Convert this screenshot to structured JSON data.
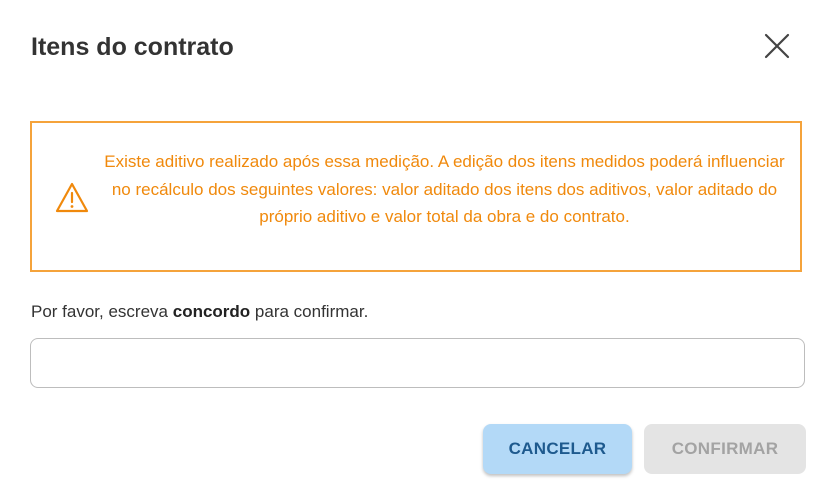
{
  "dialog": {
    "title": "Itens do contrato",
    "close_icon": "close-icon"
  },
  "alert": {
    "icon": "warning-triangle-icon",
    "message": "Existe aditivo realizado após essa medição. A edição dos itens medidos poderá influenciar no recálculo dos seguintes valores: valor aditado dos itens dos aditivos, valor aditado do próprio aditivo e valor total da obra e do contrato.",
    "color": "#f0890c",
    "border_color": "#f5a33b"
  },
  "confirm": {
    "label_prefix": "Por favor, escreva ",
    "label_keyword": "concordo",
    "label_suffix": " para confirmar.",
    "input_value": "",
    "input_placeholder": ""
  },
  "actions": {
    "cancel_label": "CANCELAR",
    "confirm_label": "CONFIRMAR",
    "cancel_bg": "#b3d9f7",
    "confirm_disabled_bg": "#e4e4e4"
  }
}
